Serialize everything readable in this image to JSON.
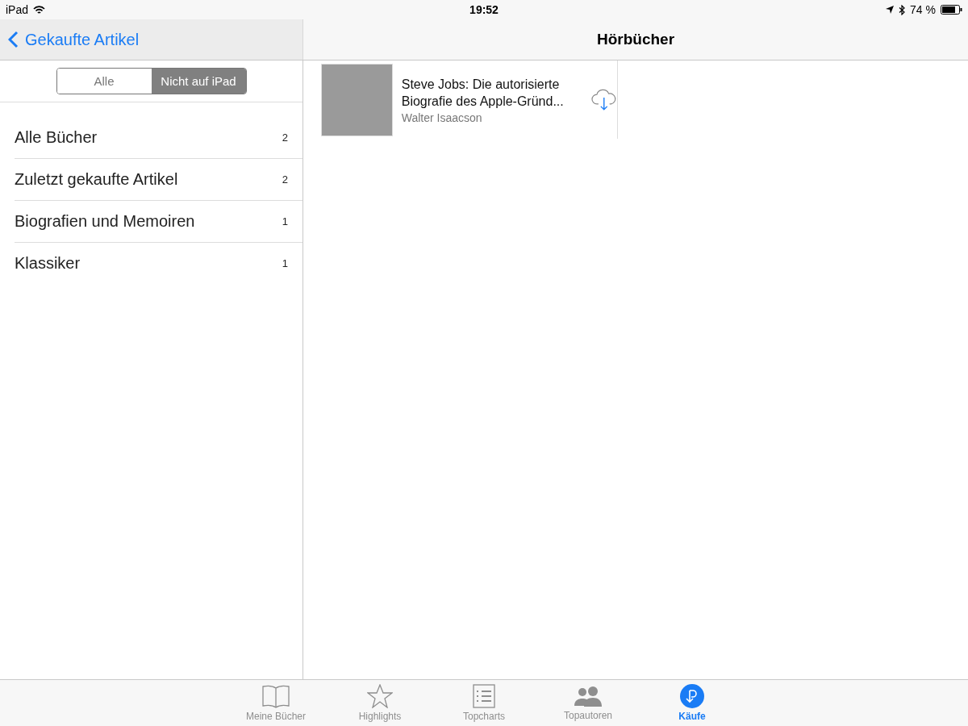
{
  "status_bar": {
    "device": "iPad",
    "time": "19:52",
    "battery": "74 %"
  },
  "sidebar": {
    "back_label": "Gekaufte Artikel",
    "segments": [
      {
        "label": "Alle",
        "selected": false
      },
      {
        "label": "Nicht auf iPad",
        "selected": true
      }
    ],
    "items": [
      {
        "label": "Alle Bücher",
        "count": "2"
      },
      {
        "label": "Zuletzt gekaufte Artikel",
        "count": "2"
      },
      {
        "label": "Biografien und Memoiren",
        "count": "1"
      },
      {
        "label": "Klassiker",
        "count": "1"
      }
    ]
  },
  "main": {
    "title": "Hörbücher",
    "items": [
      {
        "title": "Steve Jobs: Die autorisierte Biografie des Apple-Gründ...",
        "author": "Walter Isaacson"
      }
    ]
  },
  "tab_bar": [
    {
      "kind": "book",
      "label": "Meine Bücher",
      "selected": false
    },
    {
      "kind": "star",
      "label": "Highlights",
      "selected": false
    },
    {
      "kind": "list",
      "label": "Topcharts",
      "selected": false
    },
    {
      "kind": "people",
      "label": "Topautoren",
      "selected": false
    },
    {
      "kind": "purchases",
      "label": "Käufe",
      "selected": true
    }
  ]
}
